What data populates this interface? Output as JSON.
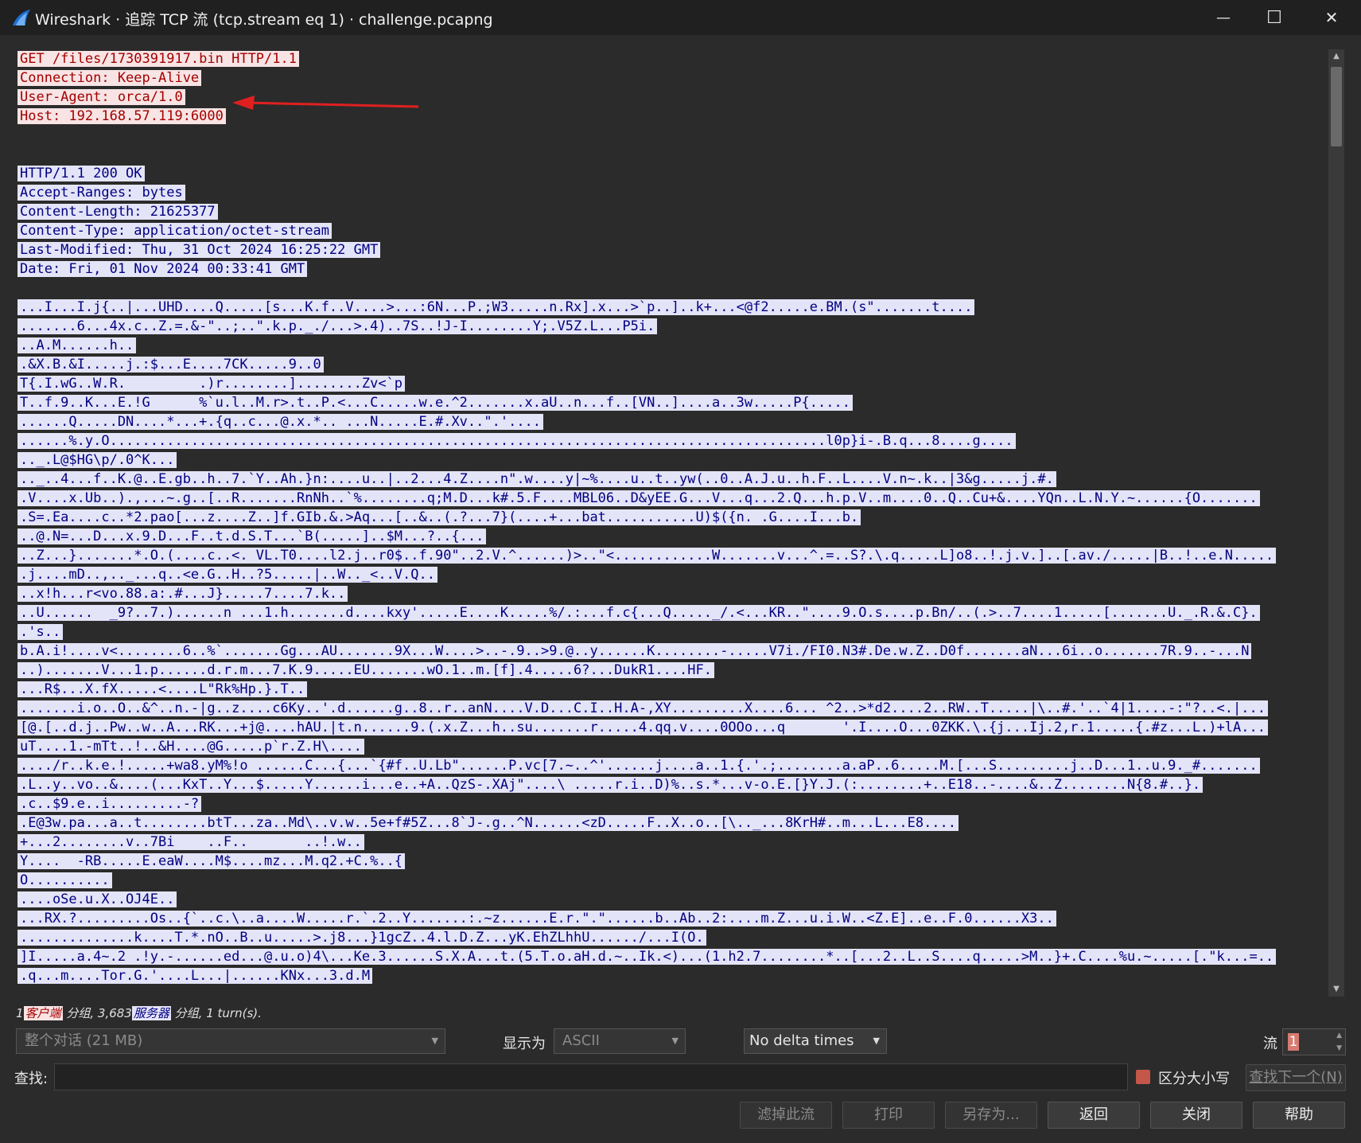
{
  "window": {
    "title": "Wireshark · 追踪 TCP 流 (tcp.stream eq 1) · challenge.pcapng",
    "minimize_glyph": "—",
    "maximize_glyph": "☐",
    "close_glyph": "✕"
  },
  "colors": {
    "client_text": "#a40000",
    "client_bg": "#f8e4e4",
    "server_text": "#000080",
    "server_bg": "#e4e4f8",
    "annotation_arrow": "#e02020"
  },
  "stream": {
    "client_lines": [
      "GET /files/1730391917.bin HTTP/1.1",
      "Connection: Keep-Alive",
      "User-Agent: orca/1.0",
      "Host: 192.168.57.119:6000"
    ],
    "server_header_lines": [
      "HTTP/1.1 200 OK",
      "Accept-Ranges: bytes",
      "Content-Length: 21625377",
      "Content-Type: application/octet-stream",
      "Last-Modified: Thu, 31 Oct 2024 16:25:22 GMT",
      "Date: Fri, 01 Nov 2024 00:33:41 GMT"
    ],
    "server_body_lines": [
      "...I...I.j{..|...UHD....Q.....[s...K.f..V....>...:6N...P.;W3.....n.Rx].x...>`p..]..k+...<@f2.....e.BM.(s\".......t....",
      ".......6...4x.c..Z.=.&-\"..;..\".k.p._./...>.4)..7S..!J-I........Y;.V5Z.L...P5i.",
      "..A.M......h..",
      ".&X.B.&I.....j.:$...E....7CK.....9..0",
      "T{.I.wG..W.R.         .)r........]........Zv<`p",
      "T..f.9..K...E.!G      %`u.l..M.r>.t..P.<...C.....w.e.^2.......x.aU..n...f..[VN..]....a..3w.....P{.....",
      "......Q.....DN....*...+.{q..c...@.x.*.. ...N.....E.#.Xv..\".'....",
      "......%.y.O........................................................................................l0p}i-.B.q...8....g....",
      ".._.L@$HG\\p/.0^K...",
      ".._..4...f..K.@..E.gb..h..7.`Y..Ah.}n:....u..|..2...4.Z....n\".w....y|~%....u..t..yw(..0..A.J.u..h.F..L....V.n~.k..|3&g.....j.#.",
      ".V....x.Ub..).,...~.g..[..R.......RnNh..`%........q;M.D...k#.5.F....MBL06..D&yEE.G...V...q...2.Q...h.p.V..m....0..Q..Cu+&....YQn..L.N.Y.~......{O.......",
      ".S=.Ea....c..*2.pao[...z....Z..]f.GIb.&.>Aq...[..&..(.?...7}(....+...bat...........U)$({n. .G....I...b.",
      "..@.N=...D...x.9.D...F..t.d.S.T...`B(.....]..$M...?..{...",
      "..Z...}.......*.O.(....c..<. VL.T0....l2.j..r0$..f.90\"..2.V.^......)>..\"<............W.......v...^.=..S?.\\.q.....L]o8..!.j.v.]..[.av./.....|B..!..e.N.....",
      ".j....mD..,.._...q..<e.G..H..?5.....|..W.._<..V.Q..",
      "..x!h...r<vo.88.a:.#...J}.....7....7.k..",
      "..U......  _9?..7.)......n ...1.h.......d....kxy'.....E....K.....%/.:...f.c{...Q....._/.<...KR..\"....9.O.s....p.Bn/..(.>..7....1.....[.......U._.R.&.C}.",
      ".'s..",
      "b.A.i!....v<........6..%`.......Gg...AU.......9X...W....>..-.9..>9.@..y......K........-.....V7i./FI0.N3#.De.w.Z..D0f.......aN...6i..o.......7R.9..-...N",
      "..).......V...1.p......d.r.m...7.K.9.....EU.......wO.1..m.[f].4.....6?...DukR1....HF.",
      "...R$...X.fX.....<....L\"Rk%Hp.}.T..",
      ".......i.o..O..&^..n.-|g..z....c6Ky..'.d......g..8..r..anN....V.D...C.I..H.A-,XY.........X....6... ^2..>*d2....2..RW..T.....|\\..#.'..`4|1....-:\"?..<.|...",
      "[@.[..d.j..Pw..w..A...RK...+j@....hAU.|t.n......9.(.x.Z...h..su.......r.....4.qq.v....0OOo...q       '.I....O...0ZKK.\\.{j...Ij.2,r.1.....{.#z...L.)+lA...",
      "uT....1.-mTt..!..&H....@G.....p`r.Z.H\\....",
      "..../r..k.e.!.....+wa8.yM%!o ......C...{...`{#f..U.Lb\"......P.vc[7.~..^'......j....a..1.{.'.;........a.aP..6.....M.[...S.........j..D...1..u.9._#.......",
      ".L..y..vo..&....(...KxT..Y...$.....Y......i...e..+A..QzS-.XAj\"....\\ .....r.i..D)%..s.*...v-o.E.[}Y.J.(:........+..E18..-....&..Z........N{8.#..}.",
      ".c..$9.e..i.........-?",
      ".E@3w.pa...a..t........btT...za..Md\\..v.w..5e+f#5Z...8`J-.g..^N......<zD.....F..X..o..[\\.._...8KrH#..m...L...E8....",
      "+...2........v..7Bi    ..F..       ..!.w..",
      "Y....  -RB.....E.eaW....M$....mz...M.q2.+C.%..{",
      "O..........",
      "....oSe.u.X..OJ4E..",
      "...RX.?.........Os..{`..c.\\..a....W.....r.`.2..Y.......:.~z......E.r.\".\"......b..Ab..2:....m.Z...u.i.W..<Z.E]..e..F.0......X3..",
      "..............k....T.*.nO..B..u.....>.j8...}1gcZ..4.l.D.Z...yK.EhZLhhU....../...I(O.",
      "]I.....a.4~.2 .!y.-......ed...@.u.o)4\\...Ke.3......S.X.A...t.(5.T.o.aH.d.~..Ik.<)...(1.h2.7........*..[...2..L..S....q.....>M..}+.C....%u.~.....[.\"k...=..",
      ".q...m....Tor.G.'....L...|......KNx...3.d.M"
    ]
  },
  "status": {
    "client_count": "1",
    "client_tag": "客户端",
    "client_suffix": "分组,",
    "server_count": "3,683",
    "server_tag": "服务器",
    "server_suffix": "分组,",
    "turns": "1 turn(s)."
  },
  "controls": {
    "conversation_select": "整个对话 (21 MB)",
    "display_as_label": "显示为",
    "display_as_value": "ASCII",
    "delta_select": "No delta times",
    "stream_label": "流",
    "stream_value": "1",
    "find_label": "查找:",
    "find_value": "",
    "case_sensitive_label": "区分大小写",
    "find_next_label": "查找下一个(N)"
  },
  "buttons": {
    "filter_out": "滤掉此流",
    "print": "打印",
    "save_as": "另存为...",
    "back": "返回",
    "close": "关闭",
    "help": "帮助"
  }
}
